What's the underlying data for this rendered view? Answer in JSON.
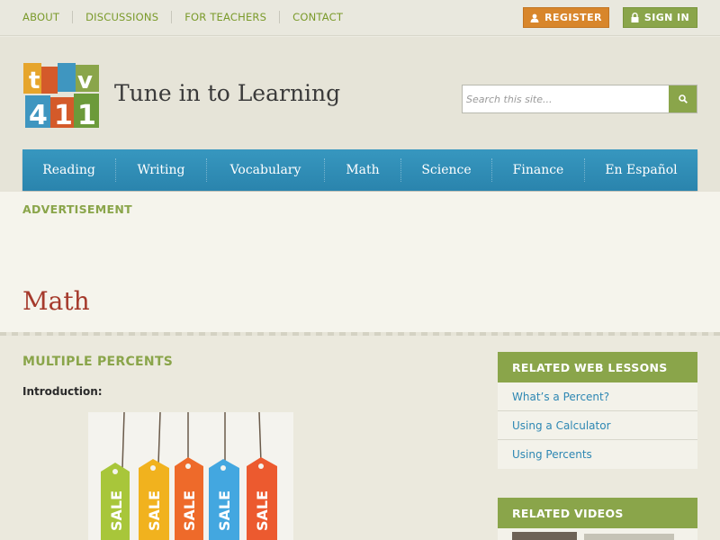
{
  "topnav": {
    "links": [
      "ABOUT",
      "DISCUSSIONS",
      "FOR TEACHERS",
      "CONTACT"
    ],
    "register_label": "REGISTER",
    "signin_label": "SIGN IN"
  },
  "header": {
    "site_name": "Tune in to Learning",
    "logo_text": "TV411",
    "search_placeholder": "Search this site..."
  },
  "mainnav": {
    "items": [
      "Reading",
      "Writing",
      "Vocabulary",
      "Math",
      "Science",
      "Finance",
      "En Español"
    ]
  },
  "band": {
    "ad_label": "ADVERTISEMENT",
    "page_title": "Math"
  },
  "lesson": {
    "title": "MULTIPLE PERCENTS",
    "intro_label": "Introduction:",
    "image_tags": [
      "SALE",
      "SALE",
      "SALE",
      "SALE",
      "SALE"
    ]
  },
  "sidebar": {
    "related_lessons_title": "RELATED WEB LESSONS",
    "related_lessons": [
      "What’s a Percent?",
      "Using a Calculator",
      "Using Percents"
    ],
    "related_videos_title": "RELATED VIDEOS"
  },
  "colors": {
    "green": "#8aa54a",
    "orange": "#d8862b",
    "blue_nav": "#2f8db7",
    "title_red": "#a53a2c"
  }
}
